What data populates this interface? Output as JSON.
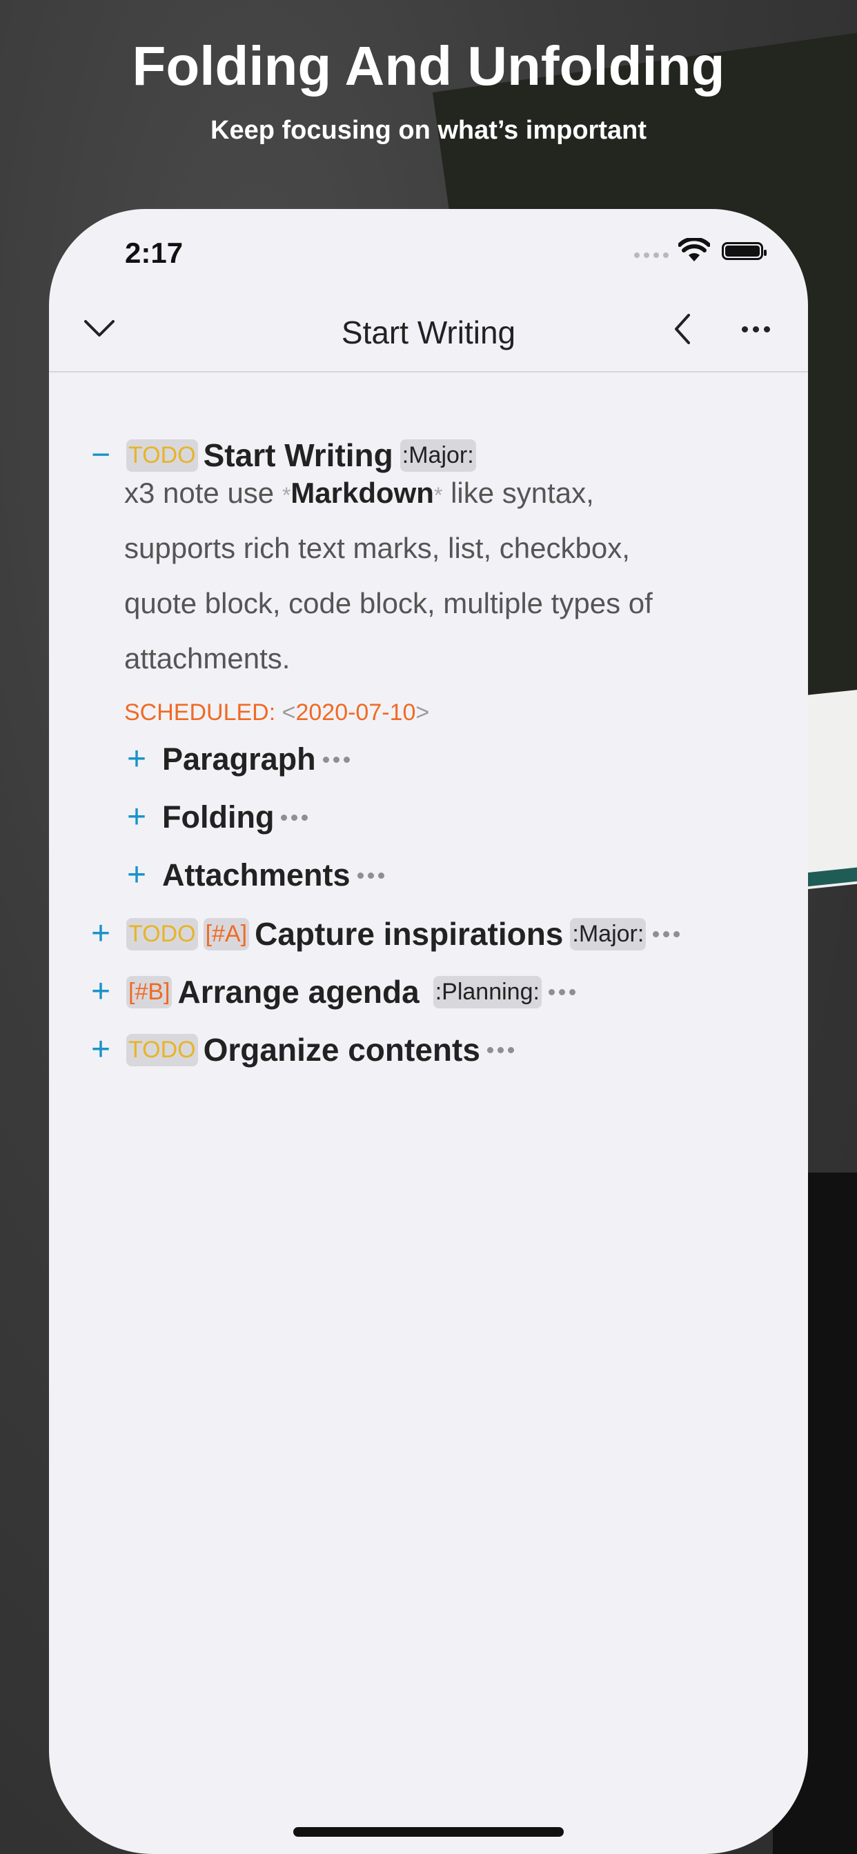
{
  "promo": {
    "title": "Folding And Unfolding",
    "subtitle": "Keep focusing on what’s important"
  },
  "status_bar": {
    "time": "2:17"
  },
  "nav": {
    "title": "Start Writing"
  },
  "outline": {
    "item1": {
      "todo": "TODO",
      "title": "Start Writing",
      "tag": ":Major:",
      "body_line1_pre": "x3 note use ",
      "body_mark": "*",
      "body_bold": "Markdown",
      "body_line1_post": " like syntax,",
      "body_line2": "supports rich text marks, list, checkbox,",
      "body_line3": "quote block, code block, multiple types of",
      "body_line4": "attachments.",
      "scheduled_label": "SCHEDULED: ",
      "scheduled_open": "<",
      "scheduled_date": "2020-07-10",
      "scheduled_close": ">",
      "children": [
        "Paragraph",
        "Folding",
        "Attachments"
      ]
    },
    "item2": {
      "todo": "TODO",
      "priority": "[#A]",
      "title": "Capture inspirations",
      "tag": ":Major:"
    },
    "item3": {
      "priority": "[#B]",
      "title": "Arrange agenda",
      "tag": ":Planning:"
    },
    "item4": {
      "todo": "TODO",
      "title": "Organize contents"
    },
    "collapse_symbol": "−",
    "expand_symbol": "+"
  },
  "colors": {
    "todo": "#e7b428",
    "priority": "#f06a24",
    "toggle": "#1a93c9",
    "scheduled": "#f06a24"
  }
}
